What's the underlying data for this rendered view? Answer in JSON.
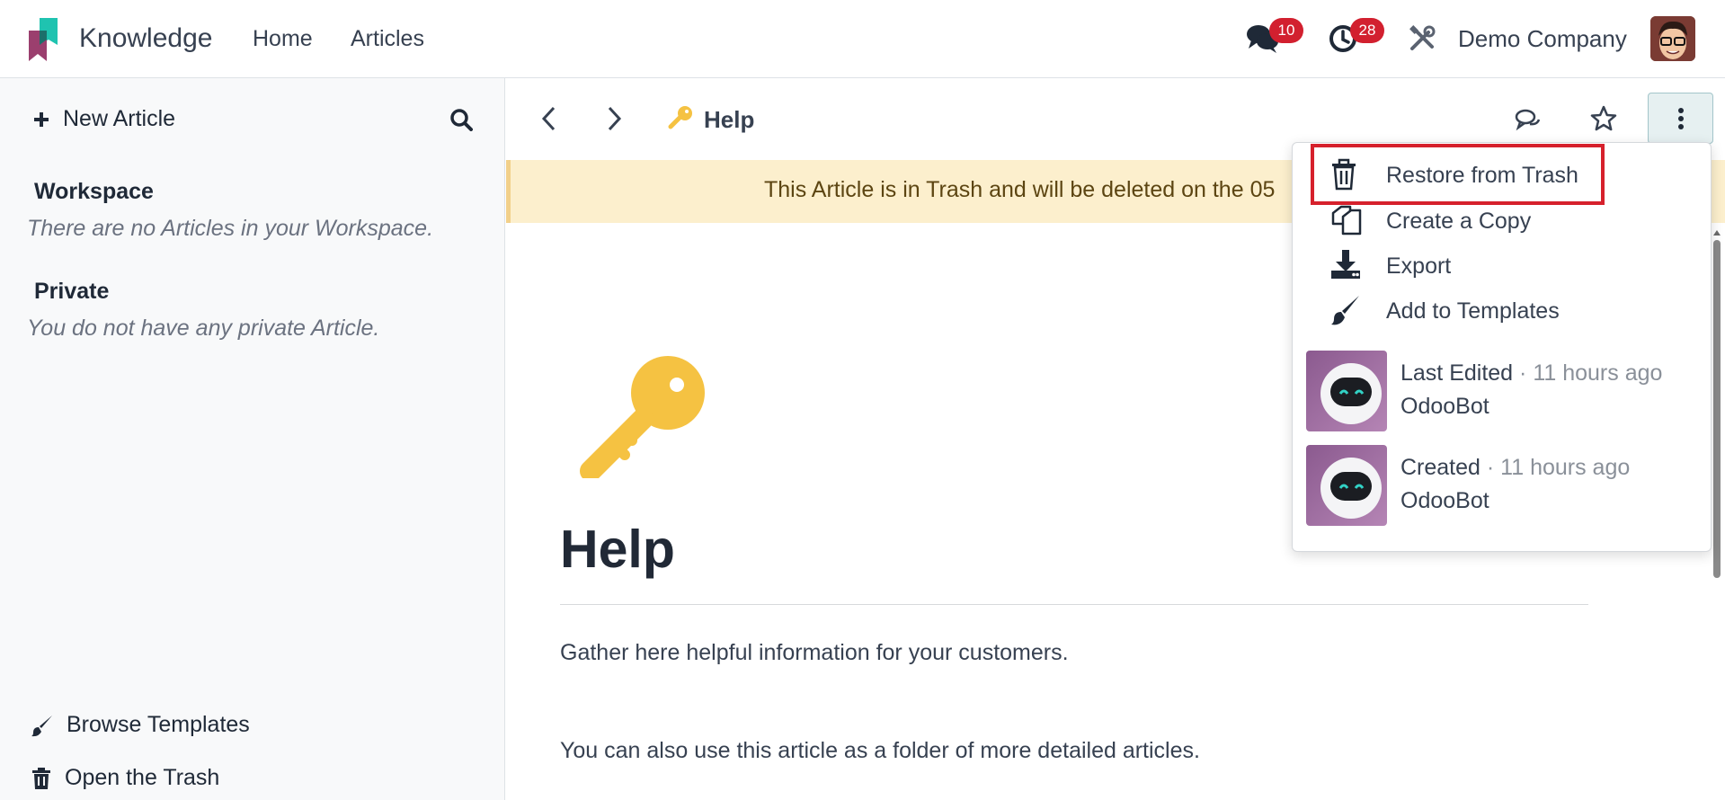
{
  "navbar": {
    "app_name": "Knowledge",
    "menu": [
      "Home",
      "Articles"
    ],
    "messages_count": "10",
    "activities_count": "28",
    "company": "Demo Company"
  },
  "sidebar": {
    "new_article": "New Article",
    "workspace": {
      "title": "Workspace",
      "empty": "There are no Articles in your Workspace."
    },
    "private": {
      "title": "Private",
      "empty": "You do not have any private Article."
    },
    "browse_templates": "Browse Templates",
    "open_trash": "Open the Trash"
  },
  "breadcrumb": {
    "title": "Help"
  },
  "alert": {
    "text": "This Article is in Trash and will be deleted on the 05"
  },
  "article": {
    "title": "Help",
    "paragraphs": [
      "Gather here helpful information for your customers.",
      "You can also use this article as a folder of more detailed articles."
    ]
  },
  "dropdown": {
    "items": [
      {
        "label": "Restore from Trash",
        "icon": "trash-icon"
      },
      {
        "label": "Create a Copy",
        "icon": "copy-icon"
      },
      {
        "label": "Export",
        "icon": "download-icon"
      },
      {
        "label": "Add to Templates",
        "icon": "brush-icon"
      }
    ],
    "last_edited": {
      "label": "Last Edited",
      "time": "11 hours ago",
      "user": "OdooBot"
    },
    "created": {
      "label": "Created",
      "time": "11 hours ago",
      "user": "OdooBot"
    }
  },
  "colors": {
    "badge": "#d2202f",
    "alert_bg": "#fcefcd",
    "highlight": "#d6212c",
    "key": "#f5c242"
  }
}
